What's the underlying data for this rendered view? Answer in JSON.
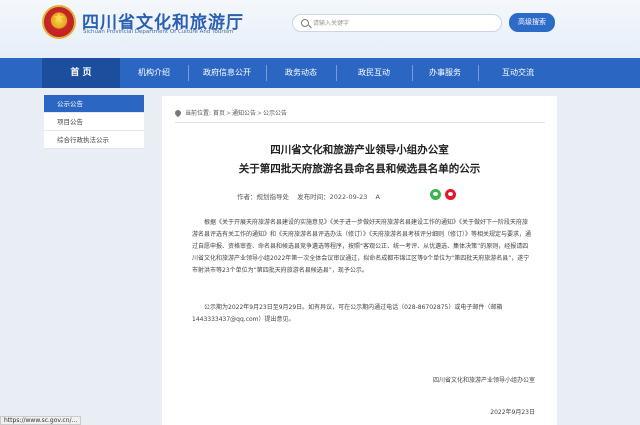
{
  "header": {
    "site_title": "四川省文化和旅游厅",
    "site_subtitle": "Sichuan Provincial Department Of Culture And Tourism",
    "search_placeholder": "请输入关键字",
    "advanced_search_label": "高级搜索"
  },
  "nav": {
    "items": [
      {
        "label": "首 页",
        "active": true
      },
      {
        "label": "机构介绍"
      },
      {
        "label": "政府信息公开"
      },
      {
        "label": "政务动态"
      },
      {
        "label": "政民互动"
      },
      {
        "label": "办事服务"
      },
      {
        "label": "互动交流"
      }
    ]
  },
  "sidebar": {
    "items": [
      {
        "label": "公示公告",
        "active": true
      },
      {
        "label": "项目公告"
      },
      {
        "label": "综合行政执法公示"
      }
    ]
  },
  "breadcrumb": {
    "prefix": "当前位置:",
    "items": [
      "首页",
      "通知公告",
      "公示公告"
    ],
    "separator": ">"
  },
  "article": {
    "title_line1": "四川省文化和旅游产业领导小组办公室",
    "title_line2": "关于第四批天府旅游名县命名县和候选县名单的公示",
    "source": "作者：规划指导处",
    "date": "发布时间：2022-09-23",
    "font_size_label": "A",
    "paragraph1": "根据《关于开展天府旅游名县建设的实施意见》《关于进一步做好天府旅游名县建设工作的通知》《关于做好下一阶段天府旅游名县评选有关工作的通知》和《天府旅游名县评选办法（修订）》《天府旅游名县考核评分细则（修订）》等相关规定与要求，通过自愿申报、资格审查、命名县和候选县竞争遴选等程序，按照“客观公正、统一考评、从优遴选、集体决策”的原则，经报请四川省文化和旅游产业领导小组2022年第一次全体会议审议通过，拟命名成都市锦江区等9个单位为“第四批天府旅游名县”，遂宁市射洪市等23个单位为“第四批天府旅游名县候选县”，现予公示。",
    "paragraph2": "公示期为2022年9月23日至9月29日。如有异议，可在公示期内通过电话（028-86702875）或电子邮件（邮箱1443333437@qq.com）提出意见。",
    "signature": "四川省文化和旅游产业领导小组办公室",
    "date_footer": "2022年9月23日"
  },
  "status_bar": {
    "url": "https://www.sc.gov.cn/..."
  },
  "colors": {
    "primary_blue": "#2b67c2",
    "nav_active": "#1b4f9e",
    "page_bg": "#e9eef5"
  }
}
